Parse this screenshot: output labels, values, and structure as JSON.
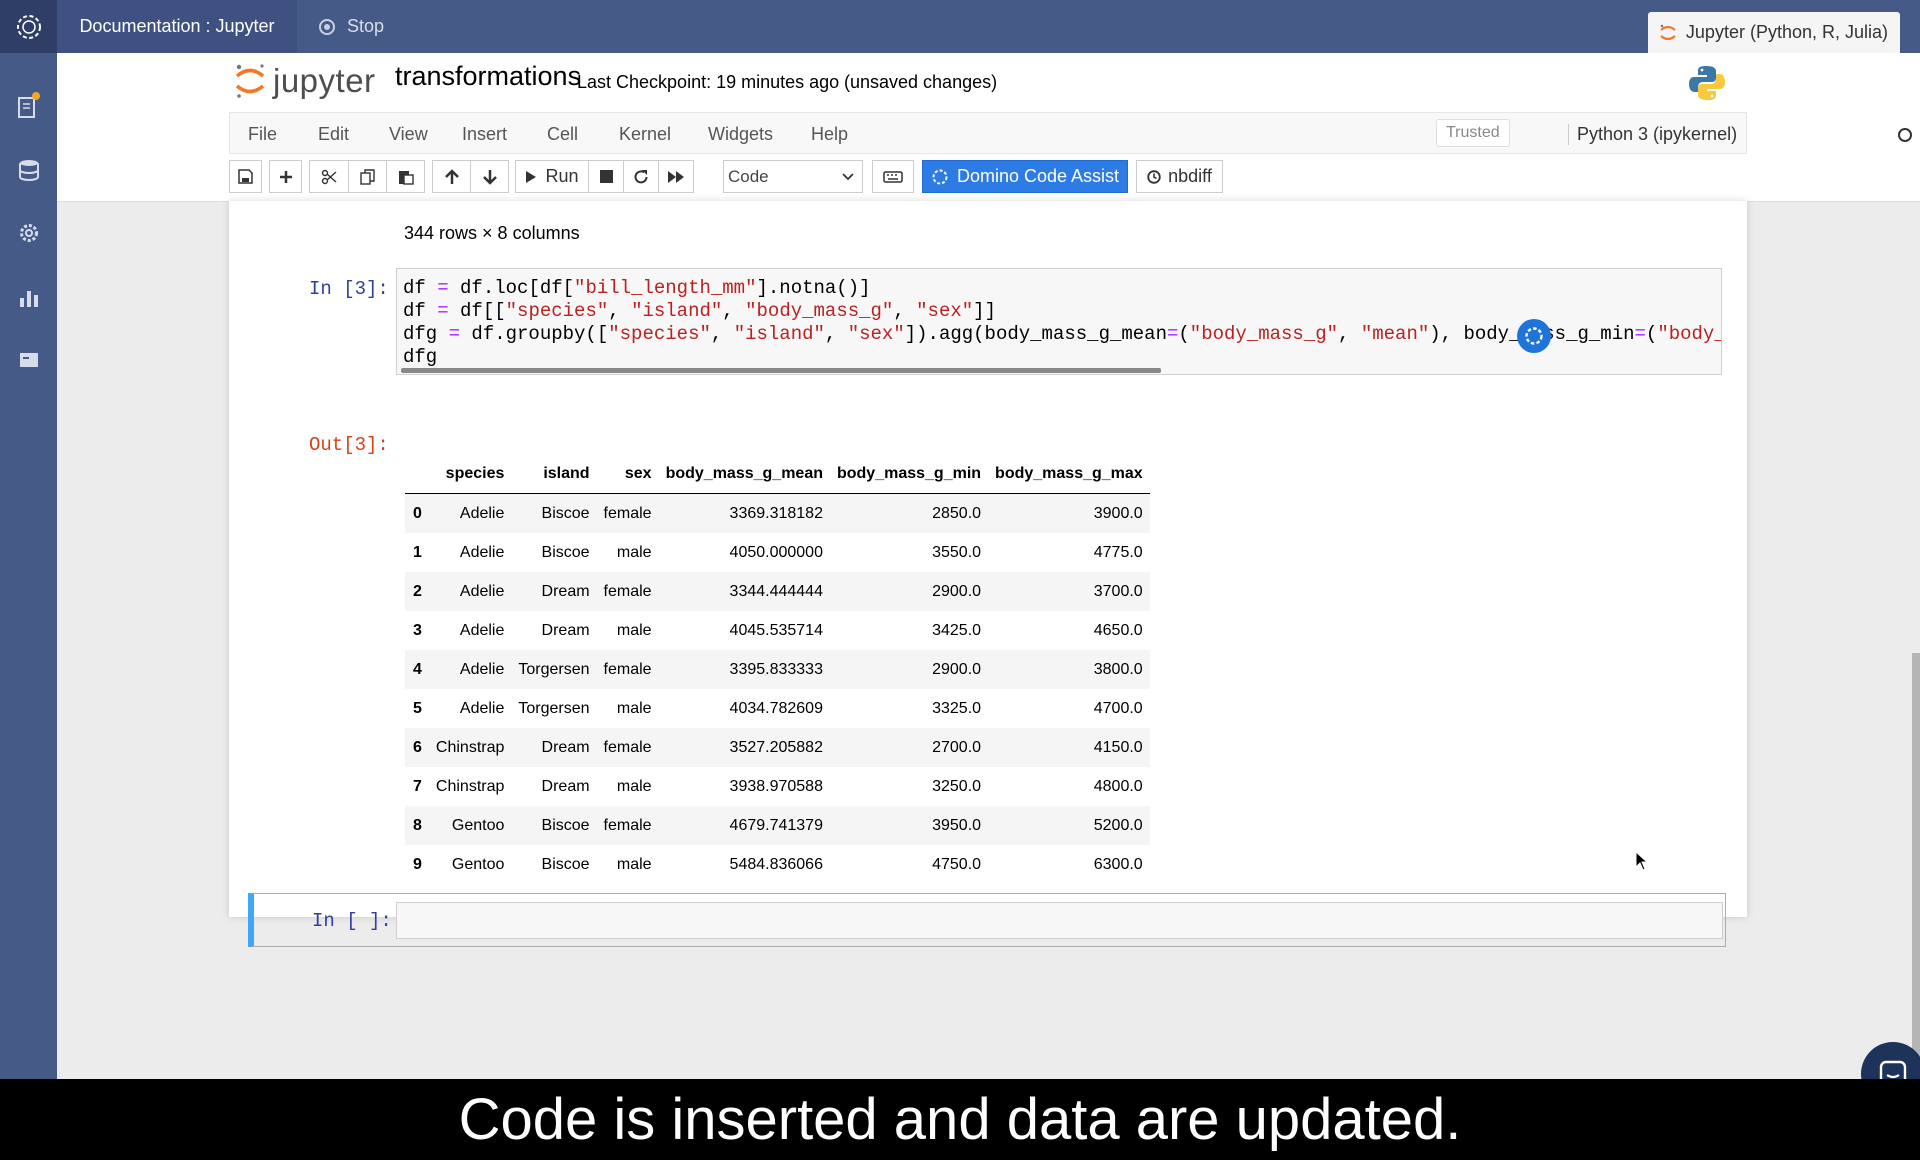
{
  "topbar": {
    "workspace_tab": "Documentation : Jupyter",
    "stop_label": "Stop",
    "kernel_tab": "Jupyter (Python, R, Julia)"
  },
  "header": {
    "logo_text": "jupyter",
    "notebook_name": "transformations",
    "checkpoint": "Last Checkpoint: 19 minutes ago",
    "unsaved": "(unsaved changes)"
  },
  "menu": {
    "items": [
      "File",
      "Edit",
      "View",
      "Insert",
      "Cell",
      "Kernel",
      "Widgets",
      "Help"
    ],
    "trusted": "Trusted",
    "kernel": "Python 3 (ipykernel)"
  },
  "toolbar": {
    "run_label": "Run",
    "cell_type": "Code",
    "code_assist_label": "Domino Code Assist",
    "nbdiff_label": "nbdiff"
  },
  "notebook": {
    "rows_cols": "344 rows × 8 columns",
    "in3_prompt": "In [3]:",
    "out3_prompt": "Out[3]:",
    "new_prompt": "In [ ]:",
    "code": {
      "line1_a": "df ",
      "line1_op": "=",
      "line1_b": " df.loc[df[",
      "line1_s1": "\"bill_length_mm\"",
      "line1_c": "].notna()]",
      "line2_a": "df ",
      "line2_op": "=",
      "line2_b": " df[[",
      "line2_s1": "\"species\"",
      "line2_c": ", ",
      "line2_s2": "\"island\"",
      "line2_d": ", ",
      "line2_s3": "\"body_mass_g\"",
      "line2_e": ", ",
      "line2_s4": "\"sex\"",
      "line2_f": "]]",
      "line3_a": "dfg ",
      "line3_op": "=",
      "line3_b": " df.groupby([",
      "line3_s1": "\"species\"",
      "line3_c": ", ",
      "line3_s2": "\"island\"",
      "line3_d": ", ",
      "line3_s3": "\"sex\"",
      "line3_e": "]).agg(body_mass_g_mean",
      "line3_op2": "=",
      "line3_f": "(",
      "line3_s4": "\"body_mass_g\"",
      "line3_g": ", ",
      "line3_s5": "\"mean\"",
      "line3_h": "), body_mass_g_min",
      "line3_op3": "=",
      "line3_i": "(",
      "line3_s6": "\"body_m",
      "line4": "dfg"
    }
  },
  "table": {
    "columns": [
      "",
      "species",
      "island",
      "sex",
      "body_mass_g_mean",
      "body_mass_g_min",
      "body_mass_g_max"
    ],
    "rows": [
      [
        "0",
        "Adelie",
        "Biscoe",
        "female",
        "3369.318182",
        "2850.0",
        "3900.0"
      ],
      [
        "1",
        "Adelie",
        "Biscoe",
        "male",
        "4050.000000",
        "3550.0",
        "4775.0"
      ],
      [
        "2",
        "Adelie",
        "Dream",
        "female",
        "3344.444444",
        "2900.0",
        "3700.0"
      ],
      [
        "3",
        "Adelie",
        "Dream",
        "male",
        "4045.535714",
        "3425.0",
        "4650.0"
      ],
      [
        "4",
        "Adelie",
        "Torgersen",
        "female",
        "3395.833333",
        "2900.0",
        "3800.0"
      ],
      [
        "5",
        "Adelie",
        "Torgersen",
        "male",
        "4034.782609",
        "3325.0",
        "4700.0"
      ],
      [
        "6",
        "Chinstrap",
        "Dream",
        "female",
        "3527.205882",
        "2700.0",
        "4150.0"
      ],
      [
        "7",
        "Chinstrap",
        "Dream",
        "male",
        "3938.970588",
        "3250.0",
        "4800.0"
      ],
      [
        "8",
        "Gentoo",
        "Biscoe",
        "female",
        "4679.741379",
        "3950.0",
        "5200.0"
      ],
      [
        "9",
        "Gentoo",
        "Biscoe",
        "male",
        "5484.836066",
        "4750.0",
        "6300.0"
      ]
    ]
  },
  "caption": "Code is inserted and data are updated.",
  "colors": {
    "topbar": "#465a87",
    "accent": "#2d7be5",
    "notification_dot": "#f5a623"
  },
  "icons": [
    "domino-logo-icon",
    "stop-icon",
    "jupyter-small-icon",
    "workspace-notes-icon",
    "data-icon",
    "settings-icon",
    "chart-icon",
    "app-icon",
    "python-logo-icon",
    "save-icon",
    "plus-icon",
    "scissors-icon",
    "copy-icon",
    "paste-icon",
    "arrow-up-icon",
    "arrow-down-icon",
    "play-icon",
    "stop-square-icon",
    "restart-icon",
    "fast-forward-icon",
    "keyboard-icon",
    "clock-icon",
    "chat-icon"
  ]
}
